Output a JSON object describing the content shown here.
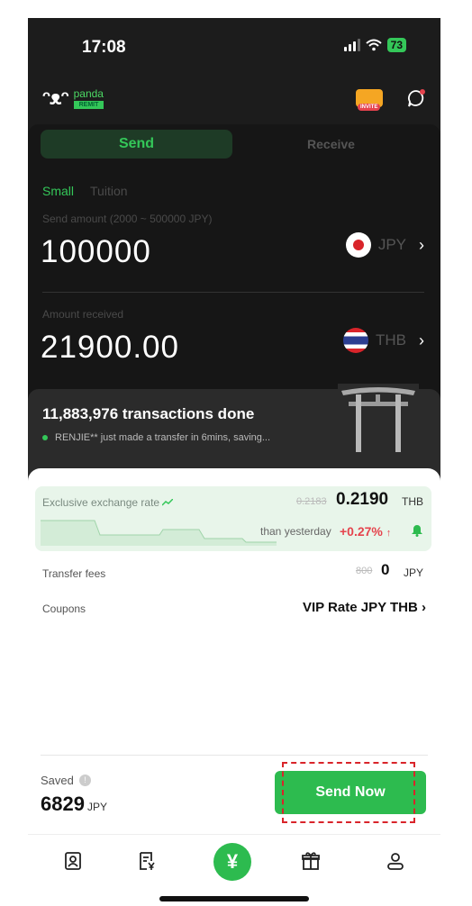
{
  "status_bar": {
    "time": "17:08",
    "battery": "73"
  },
  "header": {
    "brand": "panda",
    "brand_sub": "REMIT",
    "invite_label": "INVITE"
  },
  "tabs": {
    "send": "Send",
    "receive": "Receive"
  },
  "subtabs": {
    "small": "Small",
    "tuition": "Tuition"
  },
  "send": {
    "label": "Send amount (2000 ~ 500000 JPY)",
    "amount": "100000",
    "currency": "JPY"
  },
  "receive": {
    "label": "Amount received",
    "amount": "21900.00",
    "currency": "THB"
  },
  "promo": {
    "title": "11,883,976 transactions done",
    "line": "RENJIE** just made a transfer in 6mins, saving..."
  },
  "rate": {
    "label": "Exclusive exchange rate",
    "old": "0.2183",
    "new": "0.2190",
    "currency": "THB",
    "than_label": "than yesterday",
    "change": "+0.27%"
  },
  "fees": {
    "label": "Transfer fees",
    "old": "800",
    "new": "0",
    "currency": "JPY"
  },
  "coupons": {
    "label": "Coupons",
    "value": "VIP Rate JPY THB"
  },
  "saved": {
    "label": "Saved",
    "value": "6829",
    "currency": "JPY"
  },
  "actions": {
    "send_now": "Send Now"
  },
  "colors": {
    "accent": "#2dbb4f",
    "dark_bg": "#1c1c1c",
    "negative": "#e5434d"
  },
  "nav": [
    "contacts-icon",
    "bill-icon",
    "yen-icon",
    "gift-icon",
    "profile-icon"
  ]
}
